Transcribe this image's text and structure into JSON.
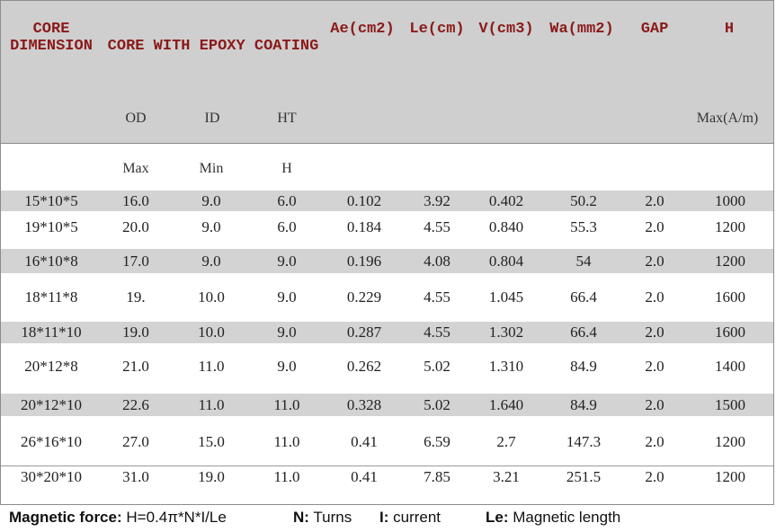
{
  "header": {
    "core_dimension": [
      "CORE",
      "DIMENSION"
    ],
    "core_with_epoxy": "CORE WITH EPOXY COATING",
    "ae": "Ae(cm2)",
    "le": "Le(cm)",
    "v": "V(cm3)",
    "wa": "Wa(mm2)",
    "gap": "GAP",
    "h": "H"
  },
  "subheader": {
    "od": "OD",
    "id": "ID",
    "ht": "HT",
    "max_am": "Max(A/m)",
    "max": "Max",
    "min": "Min",
    "h": "H"
  },
  "rows": [
    {
      "dim": "15*10*5",
      "od": "16.0",
      "id": "9.0",
      "ht": "6.0",
      "ae": "0.102",
      "le": "3.92",
      "v": "0.402",
      "wa": "50.2",
      "gap": "2.0",
      "h": "1000"
    },
    {
      "dim": "19*10*5",
      "od": "20.0",
      "id": "9.0",
      "ht": "6.0",
      "ae": "0.184",
      "le": "4.55",
      "v": "0.840",
      "wa": "55.3",
      "gap": "2.0",
      "h": "1200"
    },
    {
      "dim": "16*10*8",
      "od": "17.0",
      "id": "9.0",
      "ht": "9.0",
      "ae": "0.196",
      "le": "4.08",
      "v": "0.804",
      "wa": "54",
      "gap": "2.0",
      "h": "1200"
    },
    {
      "dim": "18*11*8",
      "od": "19.",
      "id": "10.0",
      "ht": "9.0",
      "ae": "0.229",
      "le": "4.55",
      "v": "1.045",
      "wa": "66.4",
      "gap": "2.0",
      "h": "1600"
    },
    {
      "dim": "18*11*10",
      "od": "19.0",
      "id": "10.0",
      "ht": "9.0",
      "ae": "0.287",
      "le": "4.55",
      "v": "1.302",
      "wa": "66.4",
      "gap": "2.0",
      "h": "1600"
    },
    {
      "dim": "20*12*8",
      "od": "21.0",
      "id": "11.0",
      "ht": "9.0",
      "ae": "0.262",
      "le": "5.02",
      "v": "1.310",
      "wa": "84.9",
      "gap": "2.0",
      "h": "1400"
    },
    {
      "dim": "20*12*10",
      "od": "22.6",
      "id": "11.0",
      "ht": "11.0",
      "ae": "0.328",
      "le": "5.02",
      "v": "1.640",
      "wa": "84.9",
      "gap": "2.0",
      "h": "1500"
    },
    {
      "dim": "26*16*10",
      "od": "27.0",
      "id": "15.0",
      "ht": "11.0",
      "ae": "0.41",
      "le": "6.59",
      "v": "2.7",
      "wa": "147.3",
      "gap": "2.0",
      "h": "1200"
    },
    {
      "dim": "30*20*10",
      "od": "31.0",
      "id": "19.0",
      "ht": "11.0",
      "ae": "0.41",
      "le": "7.85",
      "v": "3.21",
      "wa": "251.5",
      "gap": "2.0",
      "h": "1200"
    }
  ],
  "footer": {
    "mf_label": "Magnetic force:",
    "mf_value": "H=0.4π*N*I/Le",
    "n_label": "N:",
    "n_value": "Turns",
    "i_label": "I:",
    "i_value": "current",
    "le_label": "Le:",
    "le_value": "Magnetic length"
  }
}
